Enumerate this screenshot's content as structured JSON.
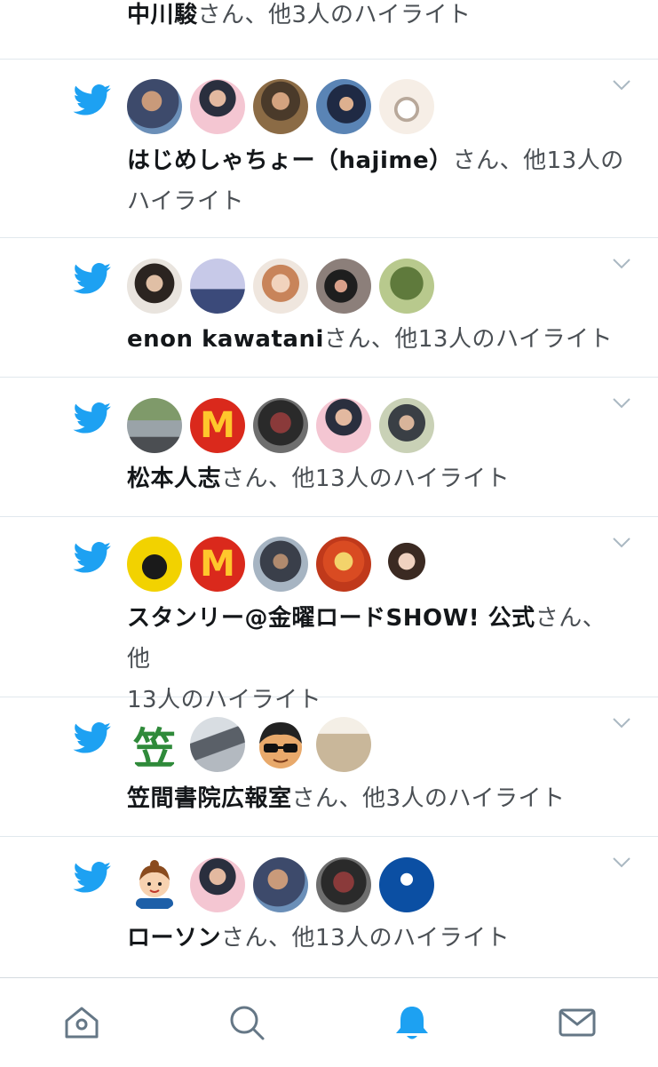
{
  "colors": {
    "twitter_blue": "#1da1f2",
    "text_primary": "#14171a",
    "text_secondary": "#4a4f54",
    "divider": "#e1e8ed"
  },
  "notifications": [
    {
      "name": "中川駿",
      "rest": "さん、他3人のハイライト"
    },
    {
      "name": "はじめしゃちょー（hajime）",
      "rest": "さん、他13人の",
      "rest2": "ハイライト"
    },
    {
      "name": "enon kawatani",
      "rest": "さん、他13人のハイライト"
    },
    {
      "name": "松本人志",
      "rest": "さん、他13人のハイライト"
    },
    {
      "name": "スタンリー@金曜ロードSHOW! 公式",
      "rest": "さん、他",
      "rest2": "13人のハイライト"
    },
    {
      "name": "笠間書院広報室",
      "rest": "さん、他3人のハイライト"
    },
    {
      "name": "ローソン",
      "rest": "さん、他13人のハイライト"
    }
  ],
  "avatar_glyphs": {
    "mcdonalds": "M",
    "kasama": "笠"
  },
  "tabbar": {
    "icons": [
      "home-icon",
      "search-icon",
      "notifications-icon",
      "messages-icon"
    ],
    "active": "notifications-icon"
  }
}
